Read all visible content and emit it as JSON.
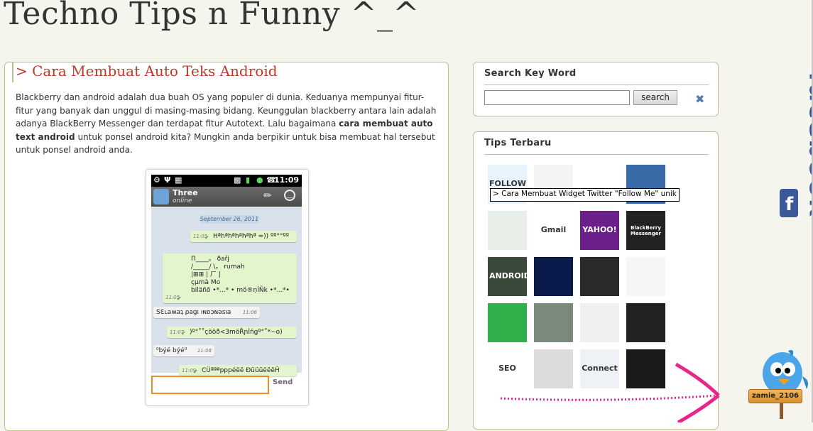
{
  "blog": {
    "title": "Techno Tips n Funny ^_^"
  },
  "post": {
    "title": "> Cara Membuat Auto Teks Android",
    "body_before": "Blackberry dan android adalah dua buah OS yang populer di dunia. Keduanya mempunyai fitur-fitur yang banyak dan unggul di masing-masing bidang. Keunggulan blackberry antara lain adalah adanya BlackBerry Messenger dan terdapat fitur Autotext. Lalu bagaimana ",
    "body_bold": "cara membuat auto text android",
    "body_after": " untuk ponsel android kita? Mungkin anda berpikir untuk bisa membuat hal tersebut untuk ponsel android anda."
  },
  "phone": {
    "time": "11:09",
    "contact_name": "Three",
    "contact_status": "online",
    "date_label": "September 26, 2011",
    "send_label": "Send",
    "messages": [
      {
        "dir": "out",
        "time": "11:05",
        "lines": [
          "Hªhªhªhªhªhª =)) ºº°°ºº"
        ]
      },
      {
        "dir": "out",
        "time": "11:05",
        "lines": [
          "П____。 ðařj",
          "/_____/ \\。  rumah",
          "|⊞⊞ | ㄏ |",
          "çµmà Mo",
          "biläñõ  •*...* • mö®ņİÑk •*...*•"
        ]
      },
      {
        "dir": "in",
        "time": "11:06",
        "lines": [
          "SƐʟaʍaʇ ρaɡı ıɴᴅɔɴəsıa"
        ]
      },
      {
        "dir": "out",
        "time": "11:07",
        "lines": [
          ")º°˚˚çööð<3möŘɲİńgº°˚*~o)"
        ]
      },
      {
        "dir": "in",
        "time": "11:08",
        "lines": [
          "⁰býé býé⁰"
        ]
      },
      {
        "dir": "out",
        "time": "11:09",
        "lines": [
          "CÜªªªpppéëë ÐüüüëëëĤ"
        ]
      }
    ]
  },
  "search": {
    "title": "Search Key Word",
    "button_label": "search",
    "value": ""
  },
  "tips": {
    "title": "Tips Terbaru",
    "tooltip": "> Cara Membuat Widget Twitter \"Follow Me\" unik",
    "thumbs": [
      {
        "label": "FOLLOW ME",
        "bg": "#e8f4fb"
      },
      {
        "label": "",
        "bg": "#f4f4f4"
      },
      {
        "label": "",
        "bg": "#ffffff"
      },
      {
        "label": "",
        "bg": "#3a6aa8"
      },
      {
        "label": "",
        "bg": "#e8eee8"
      },
      {
        "label": "Gmail",
        "bg": "#ffffff"
      },
      {
        "label": "YAHOO!",
        "bg": "#6b1f8a"
      },
      {
        "label": "BlackBerry Messenger",
        "bg": "#222222"
      },
      {
        "label": "ANDROID",
        "bg": "#3a4a3a"
      },
      {
        "label": "",
        "bg": "#0a1a4a"
      },
      {
        "label": "",
        "bg": "#2a2a2a"
      },
      {
        "label": "",
        "bg": "#f6f6f6"
      },
      {
        "label": "",
        "bg": "#2fb04a"
      },
      {
        "label": "",
        "bg": "#7a8a7a"
      },
      {
        "label": "",
        "bg": "#f0f0f0"
      },
      {
        "label": "",
        "bg": "#222222"
      },
      {
        "label": "SEO",
        "bg": "#ffffff"
      },
      {
        "label": "",
        "bg": "#dcdcdc"
      },
      {
        "label": "Connect",
        "bg": "#eef2f6"
      },
      {
        "label": "",
        "bg": "#1a1a1a"
      }
    ]
  },
  "facebook_tab": {
    "label": "facebook"
  },
  "user": {
    "name": "zamie_2106"
  },
  "colors": {
    "post_title": "#c0392b",
    "box_border": "#b5c78a",
    "facebook": "#3b5998",
    "arrow": "#e8268a"
  }
}
